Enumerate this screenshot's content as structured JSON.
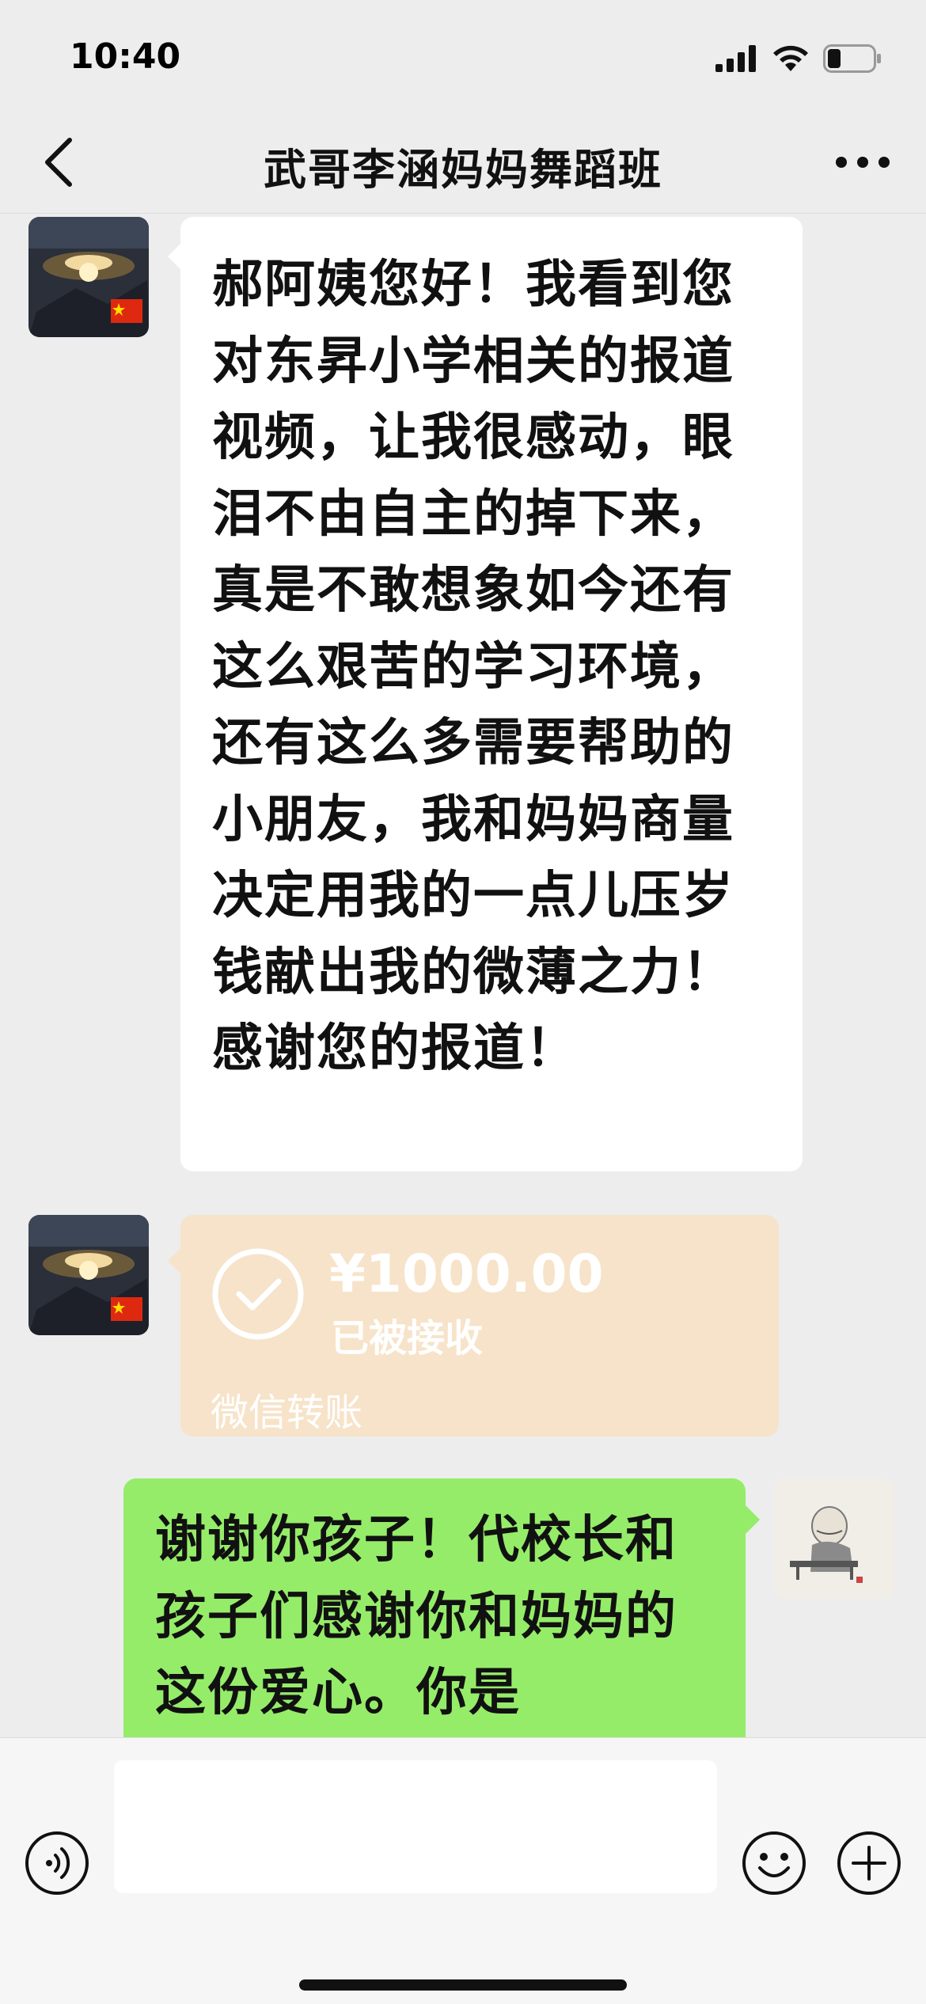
{
  "status_bar": {
    "time": "10:40"
  },
  "nav": {
    "title": "武哥李涵妈妈舞蹈班"
  },
  "messages": [
    {
      "type": "text",
      "side": "left",
      "text": "郝阿姨您好！我看到您对东昇小学相关的报道视频，让我很感动，眼泪不由自主的掉下来，真是不敢想象如今还有这么艰苦的学习环境，还有这么多需要帮助的小朋友，我和妈妈商量决定用我的一点儿压岁钱献出我的微薄之力！感谢您的报道！"
    },
    {
      "type": "transfer",
      "side": "left",
      "amount": "¥1000.00",
      "status": "已被接收",
      "label": "微信转账"
    },
    {
      "type": "text",
      "side": "right",
      "text": "谢谢你孩子！代校长和孩子们感谢你和妈妈的这份爱心。你是"
    }
  ],
  "input": {
    "value": "",
    "placeholder": ""
  },
  "colors": {
    "background": "#ededed",
    "bubble_incoming": "#ffffff",
    "bubble_outgoing": "#95ec69",
    "transfer_card": "#f7e3c9"
  }
}
